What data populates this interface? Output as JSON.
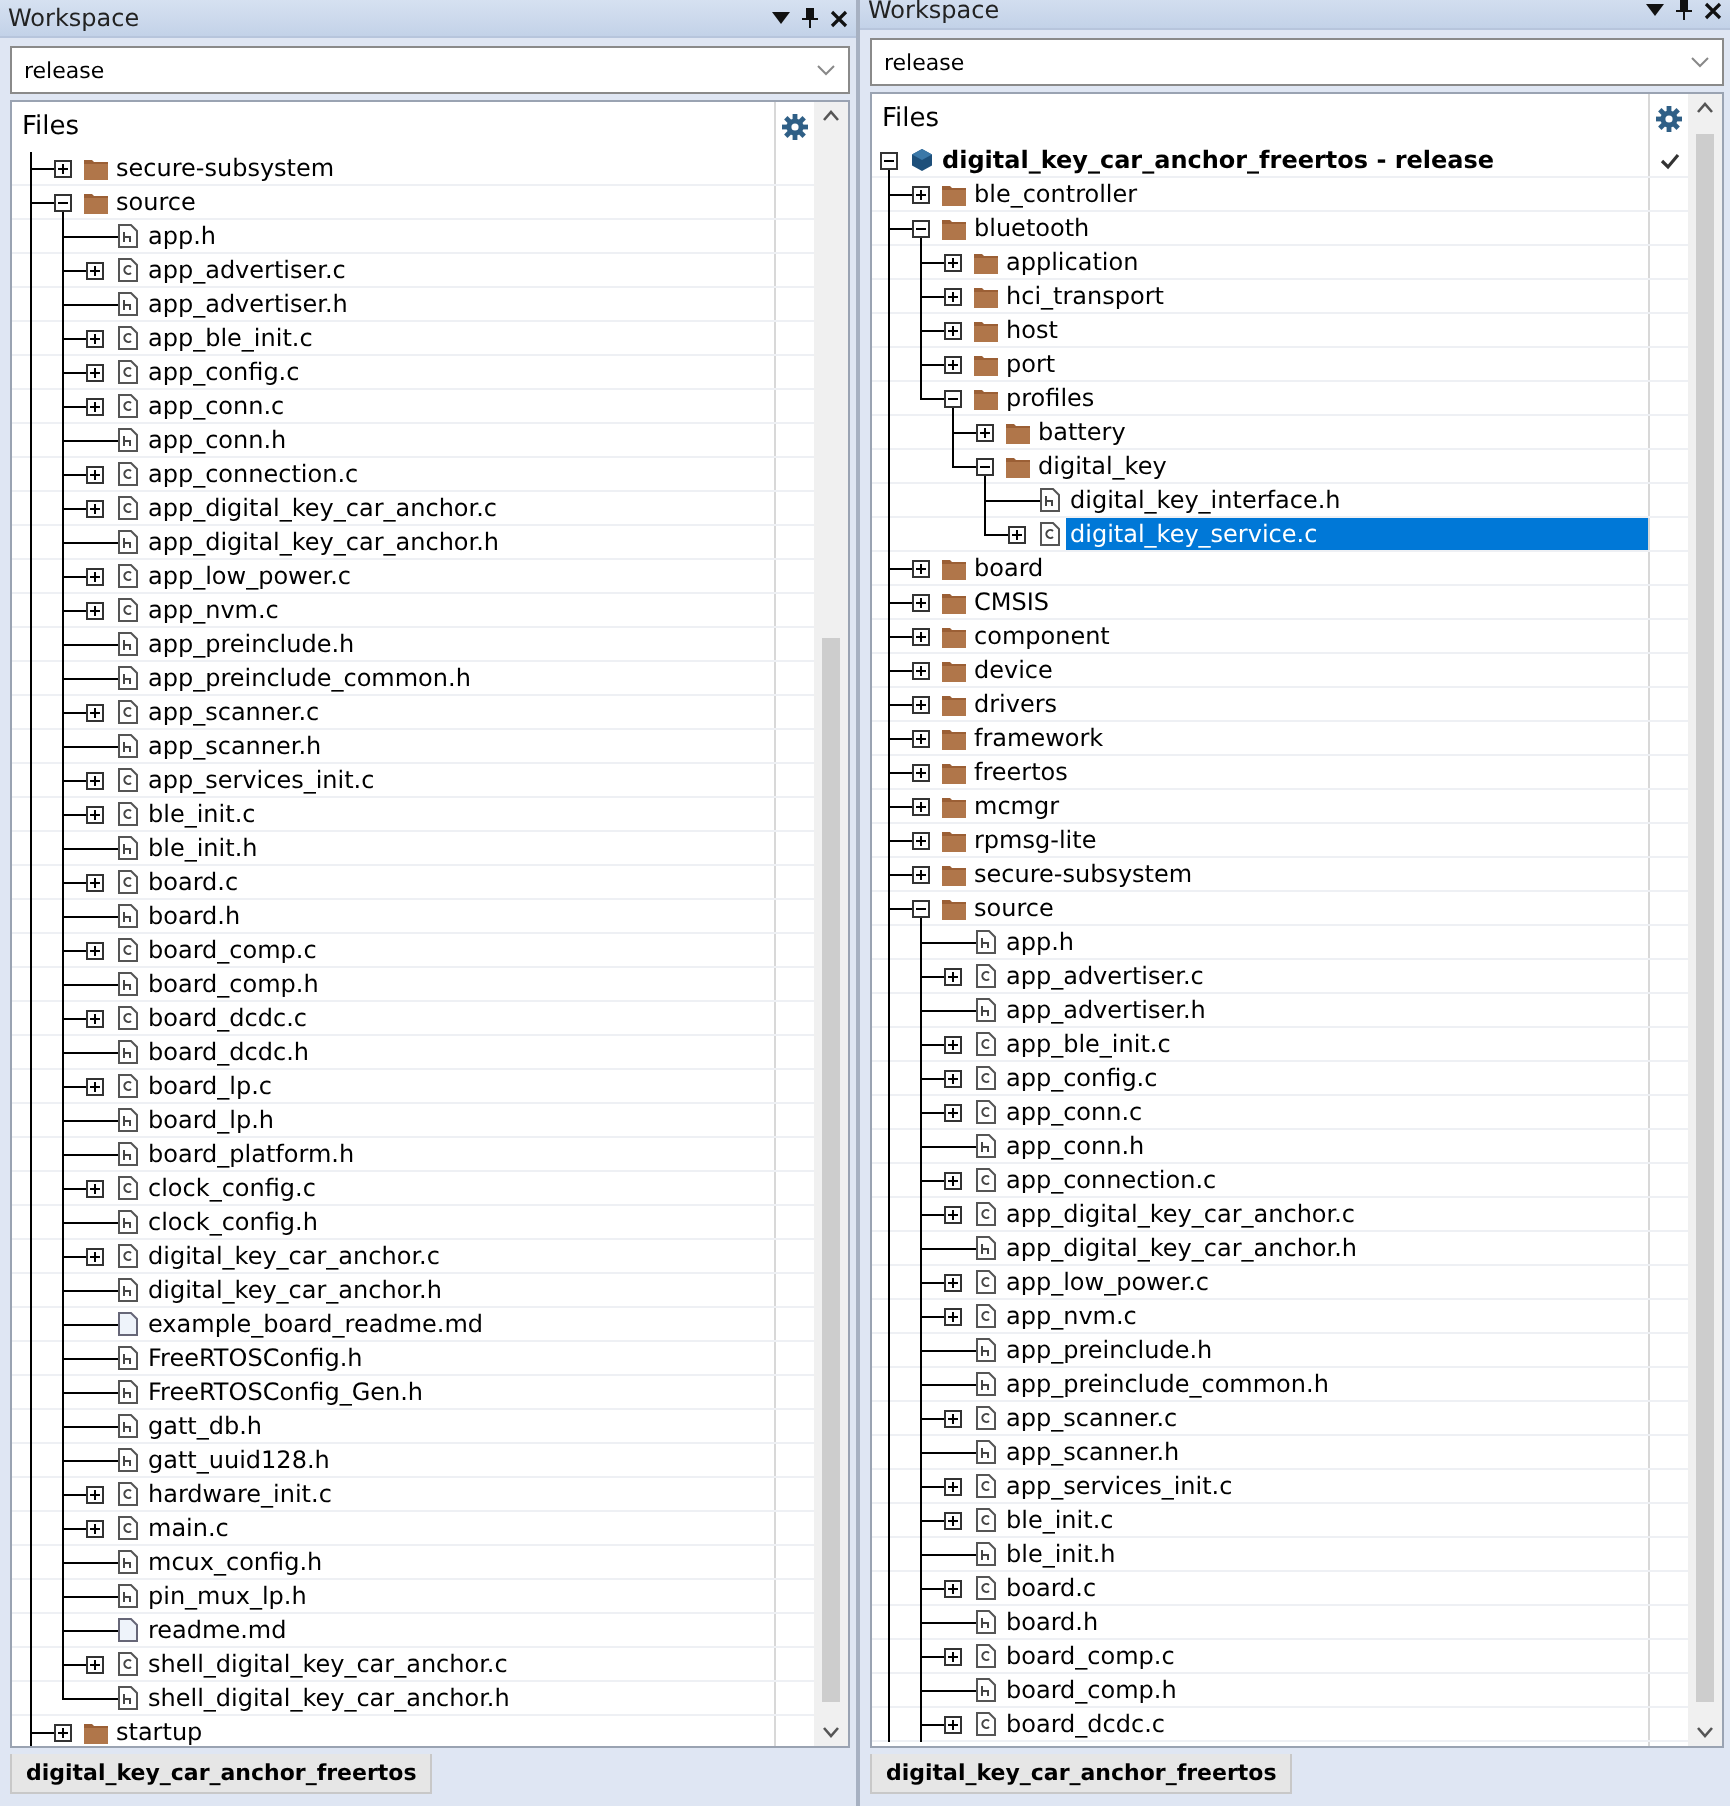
{
  "panels": [
    {
      "title": "Workspace",
      "configuration": "release",
      "files_header": "Files",
      "tree": [
        {
          "label": "secure-subsystem",
          "kind": "folder",
          "expanded": false,
          "selected": false
        },
        {
          "label": "source",
          "kind": "folder",
          "expanded": true,
          "selected": false,
          "children": [
            {
              "label": "app.h",
              "kind": "h",
              "selected": false
            },
            {
              "label": "app_advertiser.c",
              "kind": "c",
              "expanded": false,
              "selected": false
            },
            {
              "label": "app_advertiser.h",
              "kind": "h",
              "selected": false
            },
            {
              "label": "app_ble_init.c",
              "kind": "c",
              "expanded": false,
              "selected": false
            },
            {
              "label": "app_config.c",
              "kind": "c",
              "expanded": false,
              "selected": false
            },
            {
              "label": "app_conn.c",
              "kind": "c",
              "expanded": false,
              "selected": false
            },
            {
              "label": "app_conn.h",
              "kind": "h",
              "selected": false
            },
            {
              "label": "app_connection.c",
              "kind": "c",
              "expanded": false,
              "selected": false
            },
            {
              "label": "app_digital_key_car_anchor.c",
              "kind": "c",
              "expanded": false,
              "selected": false
            },
            {
              "label": "app_digital_key_car_anchor.h",
              "kind": "h",
              "selected": false
            },
            {
              "label": "app_low_power.c",
              "kind": "c",
              "expanded": false,
              "selected": false
            },
            {
              "label": "app_nvm.c",
              "kind": "c",
              "expanded": false,
              "selected": false
            },
            {
              "label": "app_preinclude.h",
              "kind": "h",
              "selected": false
            },
            {
              "label": "app_preinclude_common.h",
              "kind": "h",
              "selected": false
            },
            {
              "label": "app_scanner.c",
              "kind": "c",
              "expanded": false,
              "selected": false
            },
            {
              "label": "app_scanner.h",
              "kind": "h",
              "selected": false
            },
            {
              "label": "app_services_init.c",
              "kind": "c",
              "expanded": false,
              "selected": false
            },
            {
              "label": "ble_init.c",
              "kind": "c",
              "expanded": false,
              "selected": false
            },
            {
              "label": "ble_init.h",
              "kind": "h",
              "selected": false
            },
            {
              "label": "board.c",
              "kind": "c",
              "expanded": false,
              "selected": false
            },
            {
              "label": "board.h",
              "kind": "h",
              "selected": false
            },
            {
              "label": "board_comp.c",
              "kind": "c",
              "expanded": false,
              "selected": false
            },
            {
              "label": "board_comp.h",
              "kind": "h",
              "selected": false
            },
            {
              "label": "board_dcdc.c",
              "kind": "c",
              "expanded": false,
              "selected": false
            },
            {
              "label": "board_dcdc.h",
              "kind": "h",
              "selected": false
            },
            {
              "label": "board_lp.c",
              "kind": "c",
              "expanded": false,
              "selected": false
            },
            {
              "label": "board_lp.h",
              "kind": "h",
              "selected": false
            },
            {
              "label": "board_platform.h",
              "kind": "h",
              "selected": false
            },
            {
              "label": "clock_config.c",
              "kind": "c",
              "expanded": false,
              "selected": false
            },
            {
              "label": "clock_config.h",
              "kind": "h",
              "selected": false
            },
            {
              "label": "digital_key_car_anchor.c",
              "kind": "c",
              "expanded": false,
              "selected": false
            },
            {
              "label": "digital_key_car_anchor.h",
              "kind": "h",
              "selected": false
            },
            {
              "label": "example_board_readme.md",
              "kind": "md",
              "selected": false
            },
            {
              "label": "FreeRTOSConfig.h",
              "kind": "h",
              "selected": false
            },
            {
              "label": "FreeRTOSConfig_Gen.h",
              "kind": "h",
              "selected": false
            },
            {
              "label": "gatt_db.h",
              "kind": "h",
              "selected": false
            },
            {
              "label": "gatt_uuid128.h",
              "kind": "h",
              "selected": false
            },
            {
              "label": "hardware_init.c",
              "kind": "c",
              "expanded": false,
              "selected": false
            },
            {
              "label": "main.c",
              "kind": "c",
              "expanded": false,
              "selected": false
            },
            {
              "label": "mcux_config.h",
              "kind": "h",
              "selected": false
            },
            {
              "label": "pin_mux_lp.h",
              "kind": "h",
              "selected": false
            },
            {
              "label": "readme.md",
              "kind": "md",
              "selected": false
            },
            {
              "label": "shell_digital_key_car_anchor.c",
              "kind": "c",
              "expanded": false,
              "selected": false
            },
            {
              "label": "shell_digital_key_car_anchor.h",
              "kind": "h",
              "selected": false
            }
          ]
        },
        {
          "label": "startup",
          "kind": "folder",
          "expanded": false,
          "selected": false
        }
      ],
      "tabs": [
        {
          "label": "digital_key_car_anchor_freertos"
        }
      ]
    },
    {
      "title": "Workspace",
      "configuration": "release",
      "files_header": "Files",
      "tree": [
        {
          "label": "digital_key_car_anchor_freertos - release",
          "kind": "project",
          "expanded": true,
          "selected": false,
          "active": true,
          "children": [
            {
              "label": "ble_controller",
              "kind": "folder",
              "expanded": false,
              "selected": false
            },
            {
              "label": "bluetooth",
              "kind": "folder",
              "expanded": true,
              "selected": false,
              "children": [
                {
                  "label": "application",
                  "kind": "folder",
                  "expanded": false,
                  "selected": false
                },
                {
                  "label": "hci_transport",
                  "kind": "folder",
                  "expanded": false,
                  "selected": false
                },
                {
                  "label": "host",
                  "kind": "folder",
                  "expanded": false,
                  "selected": false
                },
                {
                  "label": "port",
                  "kind": "folder",
                  "expanded": false,
                  "selected": false
                },
                {
                  "label": "profiles",
                  "kind": "folder",
                  "expanded": true,
                  "selected": false,
                  "children": [
                    {
                      "label": "battery",
                      "kind": "folder",
                      "expanded": false,
                      "selected": false
                    },
                    {
                      "label": "digital_key",
                      "kind": "folder",
                      "expanded": true,
                      "selected": false,
                      "children": [
                        {
                          "label": "digital_key_interface.h",
                          "kind": "h",
                          "selected": false
                        },
                        {
                          "label": "digital_key_service.c",
                          "kind": "c",
                          "expanded": false,
                          "selected": true
                        }
                      ]
                    }
                  ]
                }
              ]
            },
            {
              "label": "board",
              "kind": "folder",
              "expanded": false,
              "selected": false
            },
            {
              "label": "CMSIS",
              "kind": "folder",
              "expanded": false,
              "selected": false
            },
            {
              "label": "component",
              "kind": "folder",
              "expanded": false,
              "selected": false
            },
            {
              "label": "device",
              "kind": "folder",
              "expanded": false,
              "selected": false
            },
            {
              "label": "drivers",
              "kind": "folder",
              "expanded": false,
              "selected": false
            },
            {
              "label": "framework",
              "kind": "folder",
              "expanded": false,
              "selected": false
            },
            {
              "label": "freertos",
              "kind": "folder",
              "expanded": false,
              "selected": false
            },
            {
              "label": "mcmgr",
              "kind": "folder",
              "expanded": false,
              "selected": false
            },
            {
              "label": "rpmsg-lite",
              "kind": "folder",
              "expanded": false,
              "selected": false
            },
            {
              "label": "secure-subsystem",
              "kind": "folder",
              "expanded": false,
              "selected": false
            },
            {
              "label": "source",
              "kind": "folder",
              "expanded": true,
              "selected": false,
              "children": [
                {
                  "label": "app.h",
                  "kind": "h",
                  "selected": false
                },
                {
                  "label": "app_advertiser.c",
                  "kind": "c",
                  "expanded": false,
                  "selected": false
                },
                {
                  "label": "app_advertiser.h",
                  "kind": "h",
                  "selected": false
                },
                {
                  "label": "app_ble_init.c",
                  "kind": "c",
                  "expanded": false,
                  "selected": false
                },
                {
                  "label": "app_config.c",
                  "kind": "c",
                  "expanded": false,
                  "selected": false
                },
                {
                  "label": "app_conn.c",
                  "kind": "c",
                  "expanded": false,
                  "selected": false
                },
                {
                  "label": "app_conn.h",
                  "kind": "h",
                  "selected": false
                },
                {
                  "label": "app_connection.c",
                  "kind": "c",
                  "expanded": false,
                  "selected": false
                },
                {
                  "label": "app_digital_key_car_anchor.c",
                  "kind": "c",
                  "expanded": false,
                  "selected": false
                },
                {
                  "label": "app_digital_key_car_anchor.h",
                  "kind": "h",
                  "selected": false
                },
                {
                  "label": "app_low_power.c",
                  "kind": "c",
                  "expanded": false,
                  "selected": false
                },
                {
                  "label": "app_nvm.c",
                  "kind": "c",
                  "expanded": false,
                  "selected": false
                },
                {
                  "label": "app_preinclude.h",
                  "kind": "h",
                  "selected": false
                },
                {
                  "label": "app_preinclude_common.h",
                  "kind": "h",
                  "selected": false
                },
                {
                  "label": "app_scanner.c",
                  "kind": "c",
                  "expanded": false,
                  "selected": false
                },
                {
                  "label": "app_scanner.h",
                  "kind": "h",
                  "selected": false
                },
                {
                  "label": "app_services_init.c",
                  "kind": "c",
                  "expanded": false,
                  "selected": false
                },
                {
                  "label": "ble_init.c",
                  "kind": "c",
                  "expanded": false,
                  "selected": false
                },
                {
                  "label": "ble_init.h",
                  "kind": "h",
                  "selected": false
                },
                {
                  "label": "board.c",
                  "kind": "c",
                  "expanded": false,
                  "selected": false
                },
                {
                  "label": "board.h",
                  "kind": "h",
                  "selected": false
                },
                {
                  "label": "board_comp.c",
                  "kind": "c",
                  "expanded": false,
                  "selected": false
                },
                {
                  "label": "board_comp.h",
                  "kind": "h",
                  "selected": false
                },
                {
                  "label": "board_dcdc.c",
                  "kind": "c",
                  "expanded": false,
                  "selected": false
                }
              ]
            }
          ]
        }
      ],
      "tabs": [
        {
          "label": "digital_key_car_anchor_freertos"
        }
      ]
    }
  ]
}
